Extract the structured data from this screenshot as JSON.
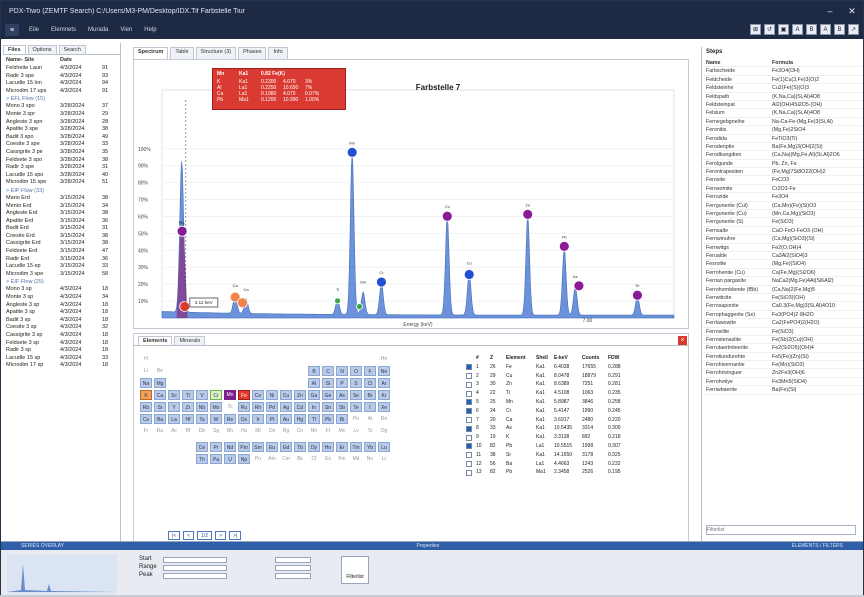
{
  "window": {
    "title": "PDX-Tiwo (ZEMTF Search) C:/Users/M3-PM/Desktop/IDX.Tif Farbstelle Tiur",
    "minimize": "–",
    "close": "✕"
  },
  "menu": {
    "home": "≡",
    "items": [
      "Eile",
      "Elemnets",
      "Murada",
      "Vien",
      "Help"
    ]
  },
  "toolbar_icons": [
    "⊠",
    "↺",
    "▣",
    "A",
    "B",
    "A",
    "B",
    "↗"
  ],
  "left": {
    "tabs": [
      "Files",
      "Options",
      "Search"
    ],
    "col_name": "Name- Sile",
    "col_date": "Date",
    "rows": [
      {
        "n": "Felsheite Laun",
        "d": "4/3/2024",
        "s": "91"
      },
      {
        "n": "Radir 3 spe",
        "d": "4/3/2024",
        "s": "93"
      },
      {
        "n": "Lacudle 15 lon",
        "d": "4/3/2024",
        "s": "94"
      },
      {
        "n": "Microdim 17 ups",
        "d": "4/3/2024",
        "s": "91"
      },
      {
        "g": "> EFL Flow (15)"
      },
      {
        "n": "Mono 3 spo",
        "d": "3/28/2024",
        "s": "37"
      },
      {
        "n": "Monte 3 spr",
        "d": "3/28/2024",
        "s": "29"
      },
      {
        "n": "Angleste 3 spn",
        "d": "3/28/2024",
        "s": "28"
      },
      {
        "n": "Apatite 3 spe",
        "d": "3/28/2024",
        "s": "38"
      },
      {
        "n": "Badit 3 spo",
        "d": "3/28/2024",
        "s": "49"
      },
      {
        "n": "Coesite 3 spe",
        "d": "3/28/2024",
        "s": "33"
      },
      {
        "n": "Cassigrite 3 pe",
        "d": "3/28/2024",
        "s": "35"
      },
      {
        "n": "Feldsete 3 spo",
        "d": "3/28/2024",
        "s": "38"
      },
      {
        "n": "Radir 3 spe",
        "d": "3/28/2024",
        "s": "31"
      },
      {
        "n": "Lacudle 15 spo",
        "d": "3/28/2024",
        "s": "40"
      },
      {
        "n": "Microdim 15 spe",
        "d": "3/28/2024",
        "s": "51"
      },
      {
        "g": "> EIP Flow (33)"
      },
      {
        "n": "Mario Erd",
        "d": "3/15/2024",
        "s": "38"
      },
      {
        "n": "Mento Erd",
        "d": "3/15/2024",
        "s": "34"
      },
      {
        "n": "Angleste Erd",
        "d": "3/15/2024",
        "s": "38"
      },
      {
        "n": "Apatite Erd",
        "d": "3/15/2024",
        "s": "36"
      },
      {
        "n": "Badit Erd",
        "d": "3/15/2024",
        "s": "31"
      },
      {
        "n": "Coesite Erd",
        "d": "3/15/2024",
        "s": "38"
      },
      {
        "n": "Cassigrite Erd",
        "d": "3/15/2024",
        "s": "38"
      },
      {
        "n": "Feldsete Erd",
        "d": "3/15/2024",
        "s": "47"
      },
      {
        "n": "Radir Erd",
        "d": "3/15/2024",
        "s": "36"
      },
      {
        "n": "Lacudle 15 ep",
        "d": "3/15/2024",
        "s": "33"
      },
      {
        "n": "Microdim 3 spe",
        "d": "3/15/2024",
        "s": "58"
      },
      {
        "g": "> EIF Flow (25)"
      },
      {
        "n": "Mono 3 sp",
        "d": "4/3/2024",
        "s": "18"
      },
      {
        "n": "Monte 3 sp",
        "d": "4/3/2024",
        "s": "34"
      },
      {
        "n": "Angleste 3 sp",
        "d": "4/3/2024",
        "s": "18"
      },
      {
        "n": "Apatite 3 sp",
        "d": "4/3/2024",
        "s": "18"
      },
      {
        "n": "Badit 3 sp",
        "d": "4/3/2024",
        "s": "18"
      },
      {
        "n": "Coesite 3 sp",
        "d": "4/3/2024",
        "s": "32"
      },
      {
        "n": "Cassigrite 3 sp",
        "d": "4/3/2024",
        "s": "18"
      },
      {
        "n": "Feldsete 3 sp",
        "d": "4/3/2024",
        "s": "18"
      },
      {
        "n": "Radir 3 sp",
        "d": "4/3/2024",
        "s": "18"
      },
      {
        "n": "Lacudle 15 sp",
        "d": "4/3/2024",
        "s": "33"
      },
      {
        "n": "Microdim 17 sp",
        "d": "4/3/2024",
        "s": "18"
      }
    ]
  },
  "center": {
    "tabs": [
      "Spectrum",
      "Table",
      "Structure (3)",
      "Phases",
      "Info"
    ]
  },
  "popup": {
    "header": [
      "Mn",
      "Ka1",
      "0.82 Fe(K)"
    ],
    "rows": [
      [
        "K",
        "Ka1",
        "0.2300",
        "4.070",
        "3%"
      ],
      [
        "Al",
        "La1",
        "0.2250",
        "10.650",
        "7%"
      ],
      [
        "Ca",
        "La1",
        "0.1980",
        "4.070",
        "0.07%"
      ],
      [
        "Pb",
        "Ma1",
        "0.1200",
        "10.990",
        "1.00%"
      ]
    ]
  },
  "chart_data": {
    "type": "line",
    "title": "Farbstelle 7",
    "xlabel": "Energy (keV)",
    "y_ticks": [
      "100%",
      "90%",
      "80%",
      "70%",
      "60%",
      "50%",
      "40%",
      "30%",
      "20%",
      "10%"
    ],
    "x_tick": "7.00",
    "cursor_label": "2.12 keV",
    "peaks": [
      {
        "x": 0.52,
        "y": 0.44,
        "label": "Fe"
      },
      {
        "x": 0.56,
        "y": 0.43,
        "label": "Fe"
      },
      {
        "x": 2.0,
        "y": 0.1,
        "label": "Ca"
      },
      {
        "x": 2.3,
        "y": 0.08,
        "label": "Ca"
      },
      {
        "x": 4.8,
        "y": 0.08,
        "label": "Ti"
      },
      {
        "x": 5.2,
        "y": 0.86,
        "label": "Mn"
      },
      {
        "x": 5.5,
        "y": 0.12,
        "label": "Mn"
      },
      {
        "x": 6.0,
        "y": 0.17,
        "label": "Cr"
      },
      {
        "x": 7.8,
        "y": 0.52,
        "label": "Cu"
      },
      {
        "x": 8.4,
        "y": 0.22,
        "label": "Cu"
      },
      {
        "x": 10.0,
        "y": 0.53,
        "label": "Zn"
      },
      {
        "x": 11.0,
        "y": 0.36,
        "label": "Pb"
      },
      {
        "x": 11.3,
        "y": 0.15,
        "label": "As"
      },
      {
        "x": 13.0,
        "y": 0.1,
        "label": "Sr"
      }
    ],
    "markers": [
      {
        "x": 0.55,
        "y": 0.44,
        "color": "purple"
      },
      {
        "x": 0.62,
        "y": 0.04,
        "color": "red"
      },
      {
        "x": 2.0,
        "y": 0.09,
        "color": "orange"
      },
      {
        "x": 2.2,
        "y": 0.06,
        "color": "orange"
      },
      {
        "x": 4.8,
        "y": 0.07,
        "color": "green"
      },
      {
        "x": 5.2,
        "y": 0.86,
        "color": "blue"
      },
      {
        "x": 5.4,
        "y": 0.04,
        "color": "green"
      },
      {
        "x": 6.0,
        "y": 0.17,
        "color": "blue"
      },
      {
        "x": 7.8,
        "y": 0.52,
        "color": "purple"
      },
      {
        "x": 8.4,
        "y": 0.21,
        "color": "blue"
      },
      {
        "x": 10.0,
        "y": 0.53,
        "color": "purple"
      },
      {
        "x": 11.0,
        "y": 0.36,
        "color": "purple"
      },
      {
        "x": 11.4,
        "y": 0.15,
        "color": "purple"
      },
      {
        "x": 13.0,
        "y": 0.1,
        "color": "purple"
      }
    ],
    "xlim": [
      0,
      14
    ],
    "ylim": [
      0,
      1
    ]
  },
  "lower": {
    "tabs": [
      "Elements",
      "Minerals"
    ],
    "close": "×",
    "pager": [
      "|<",
      "<",
      "1/2",
      ">",
      ">|"
    ],
    "el_header": [
      "#",
      "Z",
      "Element",
      "Shell",
      "E-keV",
      "Counts",
      "FDW"
    ],
    "el_rows": [
      [
        "1",
        "26",
        "Fe",
        "Ka1",
        "6.4038",
        "17655",
        "0.288"
      ],
      [
        "2",
        "29",
        "Cu",
        "Ka1",
        "8.0478",
        "18879",
        "0.291"
      ],
      [
        "3",
        "30",
        "Zn",
        "Ka1",
        "8.6389",
        "7251",
        "0.281"
      ],
      [
        "4",
        "22",
        "Ti",
        "Ka1",
        "4.5108",
        "1063",
        "0.235"
      ],
      [
        "5",
        "25",
        "Mn",
        "Ka1",
        "5.8987",
        "3846",
        "0.258"
      ],
      [
        "6",
        "24",
        "Cr",
        "Ka1",
        "5.4147",
        "1990",
        "0.245"
      ],
      [
        "7",
        "20",
        "Ca",
        "Ka1",
        "3.6917",
        "2480",
        "0.220"
      ],
      [
        "8",
        "33",
        "As",
        "Ka1",
        "10.5435",
        "3314",
        "0.300"
      ],
      [
        "9",
        "19",
        "K",
        "Ka1",
        "3.3138",
        "892",
        "0.218"
      ],
      [
        "10",
        "82",
        "Pb",
        "La1",
        "10.5515",
        "1998",
        "0.307"
      ],
      [
        "11",
        "38",
        "Sr",
        "Ka1",
        "14.1650",
        "3178",
        "0.325"
      ],
      [
        "12",
        "56",
        "Ba",
        "La1",
        "4.4663",
        "1243",
        "0.232"
      ],
      [
        "13",
        "82",
        "Pb",
        "Ma1",
        "2.3458",
        "2526",
        "0.195"
      ]
    ],
    "ptable": [
      [
        "H",
        "",
        "",
        "",
        "",
        "",
        "",
        "",
        "",
        "",
        "",
        "",
        "",
        "",
        "",
        "",
        "",
        "He"
      ],
      [
        "Li",
        "Be",
        "",
        "",
        "",
        "",
        "",
        "",
        "",
        "",
        "",
        "",
        "B",
        "C",
        "N",
        "O",
        "F",
        "Ne"
      ],
      [
        "Na",
        "Mg",
        "",
        "",
        "",
        "",
        "",
        "",
        "",
        "",
        "",
        "",
        "Al",
        "Si",
        "P",
        "S",
        "Cl",
        "Ar"
      ],
      [
        "K",
        "Ca",
        "Sc",
        "Ti",
        "V",
        "Cr",
        "Mn",
        "Fe",
        "Co",
        "Ni",
        "Cu",
        "Zn",
        "Ga",
        "Ge",
        "As",
        "Se",
        "Br",
        "Kr"
      ],
      [
        "Rb",
        "Sr",
        "Y",
        "Zr",
        "Nb",
        "Mo",
        "Tc",
        "Ru",
        "Rh",
        "Pd",
        "Ag",
        "Cd",
        "In",
        "Sn",
        "Sb",
        "Te",
        "I",
        "Xe"
      ],
      [
        "Cs",
        "Ba",
        "La",
        "Hf",
        "Ta",
        "W",
        "Re",
        "Os",
        "Ir",
        "Pt",
        "Au",
        "Hg",
        "Tl",
        "Pb",
        "Bi",
        "Po",
        "At",
        "Rn"
      ],
      [
        "Fr",
        "Ra",
        "Ac",
        "Rf",
        "Db",
        "Sg",
        "Bh",
        "Hs",
        "Mt",
        "Ds",
        "Rg",
        "Cn",
        "Nh",
        "Fl",
        "Mc",
        "Lv",
        "Ts",
        "Og"
      ]
    ],
    "lanth": [
      "Ce",
      "Pr",
      "Nd",
      "Pm",
      "Sm",
      "Eu",
      "Gd",
      "Tb",
      "Dy",
      "Ho",
      "Er",
      "Tm",
      "Yb",
      "Lu"
    ],
    "actin": [
      "Th",
      "Pa",
      "U",
      "Np",
      "Pu",
      "Am",
      "Cm",
      "Bk",
      "Cf",
      "Es",
      "Fm",
      "Md",
      "No",
      "Lr"
    ]
  },
  "right": {
    "header": "Steps",
    "rows": [
      [
        "Name",
        "Formula"
      ],
      [
        "Farbscheide",
        "Fe3O4(OH)"
      ],
      [
        "Feldcheide",
        "Fe(1)Cu(3,Fe)3(O)2"
      ],
      [
        "Feldsteinhe",
        "Cu2(Fe)(S)(O)3"
      ],
      [
        "Feldspath",
        "(K,Na,Ca)(Si,Al)4O8"
      ],
      [
        "Feldsteinpat",
        "Al2(OH)4Si2O5·(OH)"
      ],
      [
        "Felsium",
        "(K,Na,Ca)(Si,Al)4O8"
      ],
      [
        "Fernegebgneihe",
        "Na-Ca-Fe-(Mg,Fe)3(Si,Al)"
      ],
      [
        "Feronitis",
        "(Mg,Fe)2SiO4"
      ],
      [
        "Ferodida",
        "FeTiO3(Ti)"
      ],
      [
        "Ferodenptie",
        "Ba(Fe,Mg)3(OH)2(Si)"
      ],
      [
        "Ferodkungdien",
        "(Ca,Na)(Mg,Fe,Al)(Si,Al)2O6"
      ],
      [
        "Ferolgunde",
        "Pb, Zn, Fe"
      ],
      [
        "Ferontrapesiten",
        "(Fe,Mg)7Si8O22(OH)2"
      ],
      [
        "Ferosite",
        "FeCO3"
      ],
      [
        "Ferosomite",
        "Cr2O3·Fe"
      ],
      [
        "Ferrozide",
        "Fe3O4"
      ],
      [
        "Ferrgunerite (Cul)",
        "(Ca,Mn)(Fe)(Si)O3"
      ],
      [
        "Ferrgunerite (Cu)",
        "(Mn,Ca,Mg)(SiO3)"
      ],
      [
        "Ferrgunerite (S)",
        "Fe(SiO3)"
      ],
      [
        "Fernsalte",
        "CaO·FeO·FeO3·(OH)"
      ],
      [
        "Fernwinuhre",
        "(Ca,Mg)(SiO3)(Si)"
      ],
      [
        "Fernwitgs",
        "Fe2(O,OH)4"
      ],
      [
        "Ferualde",
        "Ca3Al2(SiO4)3"
      ],
      [
        "Fesrolite",
        "(Mg,Fe)(SiO4)"
      ],
      [
        "Ferrohenite (Cu)",
        "Ca(Fe,Mg)(Si2O6)"
      ],
      [
        "Ferrian pargasite",
        "NaCa2(Mg,Fe)4Al(Si6Al2)"
      ],
      [
        "Ferrohornblende (fBb)",
        "(Ca,Na)2(Fe,Mg)5"
      ],
      [
        "Ferrwiticite",
        "Fe(SiO3)(OH)"
      ],
      [
        "Ferrosaponite",
        "Ca0.3(Fe,Mg)3(Si,Al)4O10"
      ],
      [
        "Ferrophaggerite (Se)",
        "Fe3(PO4)2·8H2O"
      ],
      [
        "Ferrlawowite",
        "Ca2(FePO4)2(H2O)"
      ],
      [
        "Ferrosilite",
        "Fe(SiO3)"
      ],
      [
        "Ferrostenaslite",
        "Fe(Sb)2(Cu)(OH)"
      ],
      [
        "Ferrutaertniteerite",
        "Fe2(Si2O5)(OH)4"
      ],
      [
        "Ferrotiundurehte",
        "Fe5(Fe)(Zn)(Si)"
      ],
      [
        "Ferrohivernantie",
        "Fe(Mn)(SiO3)"
      ],
      [
        "Ferrohrivinguer",
        "Zn2Fe3(OH)6"
      ],
      [
        "Ferrohotiye",
        "Fe3Mn5(SiO4)"
      ],
      [
        "Ferriwbaerite",
        "Ba(Fe)(Si)"
      ]
    ],
    "filter_placeholder": "Filterlist"
  },
  "bottom": {
    "bar_left": "SERIES OVERLAY",
    "bar_mid": "Properties",
    "bar_right": "ELEMENTS / FILTERS",
    "labels": [
      "Start",
      "Range",
      "Peak"
    ],
    "button": "Filterlist"
  }
}
